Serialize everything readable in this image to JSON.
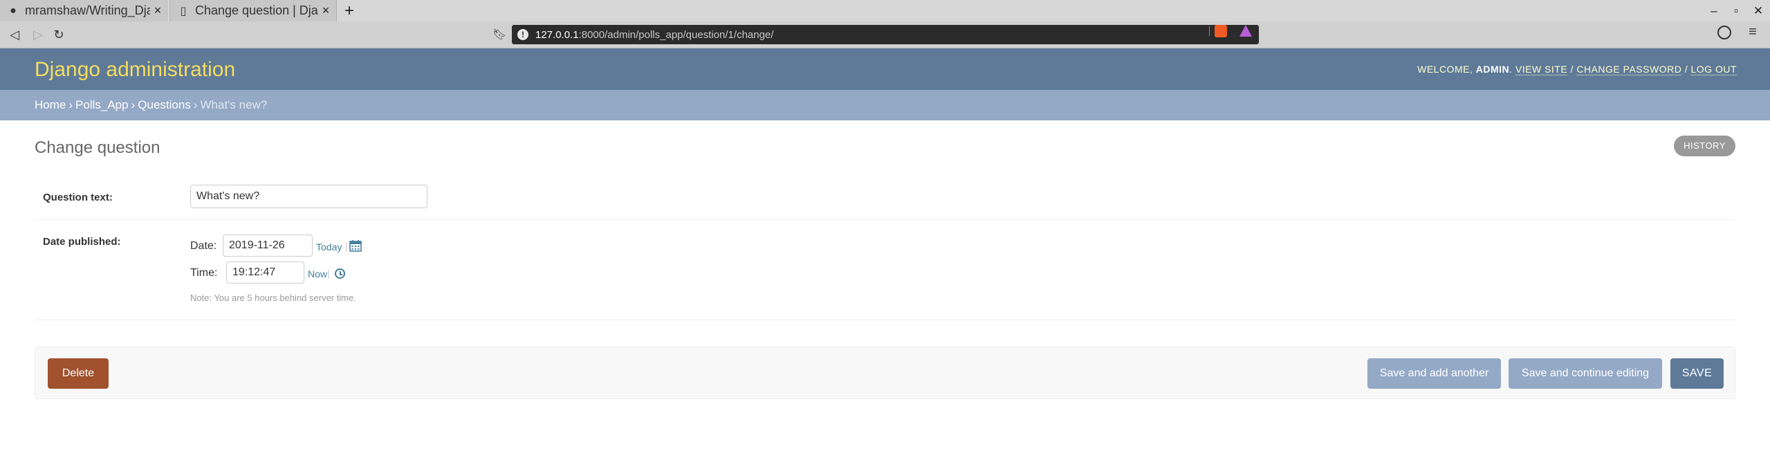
{
  "browser": {
    "tabs": [
      {
        "title": "mramshaw/Writing_Dja",
        "icon": "github-icon",
        "active": false
      },
      {
        "title": "Change question | Djan",
        "icon": "page-icon",
        "active": true
      }
    ],
    "new_tab_label": "+",
    "window_controls": {
      "minimize": "–",
      "maximize": "▫",
      "close": "✕"
    },
    "url": {
      "host": "127.0.0.1",
      "rest": ":8000/admin/polls_app/question/1/change/"
    }
  },
  "header": {
    "branding": "Django administration",
    "welcome": "WELCOME,",
    "username": "ADMIN",
    "links": {
      "view_site": "VIEW SITE",
      "change_password": "CHANGE PASSWORD",
      "log_out": "LOG OUT"
    }
  },
  "breadcrumbs": {
    "home": "Home",
    "app": "Polls_App",
    "model": "Questions",
    "current": "What's new?",
    "separator": "›"
  },
  "content": {
    "title": "Change question",
    "history_label": "HISTORY",
    "question_text": {
      "label": "Question text:",
      "value": "What's new?"
    },
    "date_published": {
      "label": "Date published:",
      "date_label": "Date:",
      "date_value": "2019-11-26",
      "today_link": "Today",
      "time_label": "Time:",
      "time_value": "19:12:47",
      "now_link": "Now",
      "separator": "|",
      "note": "Note: You are 5 hours behind server time."
    }
  },
  "submit_row": {
    "delete": "Delete",
    "save_add_another": "Save and add another",
    "save_continue": "Save and continue editing",
    "save": "SAVE"
  },
  "colors": {
    "header_bg": "#5f7a99",
    "branding": "#f5dd5d",
    "breadcrumbs_bg": "#94a9c6",
    "delete_bg": "#a1512e",
    "save_bg": "#5f7a99",
    "secondary_save_bg": "#94a9c6",
    "link": "#447e9b"
  }
}
